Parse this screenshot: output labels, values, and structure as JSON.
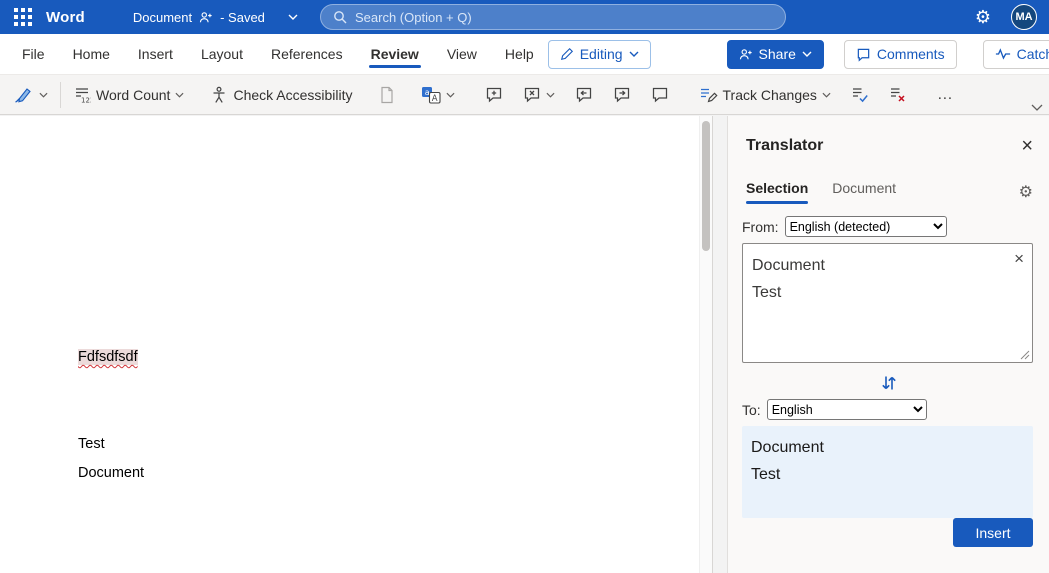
{
  "topbar": {
    "app_name": "Word",
    "document_name": "Document",
    "save_status": "- Saved",
    "search_placeholder": "Search (Option + Q)",
    "avatar_initials": "MA"
  },
  "menu": {
    "items": [
      "File",
      "Home",
      "Insert",
      "Layout",
      "References",
      "Review",
      "View",
      "Help"
    ],
    "active": "Review"
  },
  "actions": {
    "editing_label": "Editing",
    "share_label": "Share",
    "comments_label": "Comments",
    "catchup_label": "Catch up"
  },
  "ribbon": {
    "word_count_label": "Word Count",
    "check_accessibility_label": "Check Accessibility",
    "track_changes_label": "Track Changes",
    "more_label": "…"
  },
  "document": {
    "lines": [
      "Fdfsdfsdf",
      "Test",
      "Document"
    ]
  },
  "translator": {
    "title": "Translator",
    "tabs": [
      "Selection",
      "Document"
    ],
    "active_tab": "Selection",
    "from_label": "From:",
    "from_value": "English (detected)",
    "source_lines": [
      "Document",
      "Test"
    ],
    "to_label": "To:",
    "to_value": "English",
    "result_lines": [
      "Document",
      "Test"
    ],
    "insert_label": "Insert"
  },
  "icons": {
    "gear_glyph": "⚙",
    "close_glyph": "×",
    "clear_glyph": "×"
  },
  "colors": {
    "brand_blue": "#185abd",
    "result_bg": "#e9f2fb",
    "error_red": "#d13438"
  }
}
